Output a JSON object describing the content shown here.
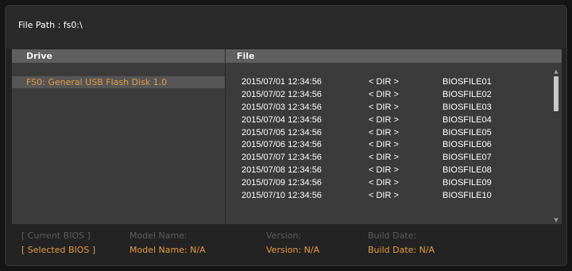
{
  "header": {
    "file_path": "File Path : fs0:\\"
  },
  "drive_panel": {
    "title": "Drive",
    "items": [
      {
        "label": "FS0: General USB Flash Disk 1.0",
        "selected": true
      }
    ]
  },
  "file_panel": {
    "title": "File",
    "rows": [
      {
        "date": "2015/07/01 12:34:56",
        "type": "< DIR >",
        "name": "BIOSFILE01"
      },
      {
        "date": "2015/07/02 12:34:56",
        "type": "< DIR >",
        "name": "BIOSFILE02"
      },
      {
        "date": "2015/07/03 12:34:56",
        "type": "< DIR >",
        "name": "BIOSFILE03"
      },
      {
        "date": "2015/07/04 12:34:56",
        "type": "< DIR >",
        "name": "BIOSFILE04"
      },
      {
        "date": "2015/07/05 12:34:56",
        "type": "< DIR >",
        "name": "BIOSFILE05"
      },
      {
        "date": "2015/07/06 12:34:56",
        "type": "< DIR >",
        "name": "BIOSFILE06"
      },
      {
        "date": "2015/07/07 12:34:56",
        "type": "< DIR >",
        "name": "BIOSFILE07"
      },
      {
        "date": "2015/07/08 12:34:56",
        "type": "< DIR >",
        "name": "BIOSFILE08"
      },
      {
        "date": "2015/07/09 12:34:56",
        "type": "< DIR >",
        "name": "BIOSFILE09"
      },
      {
        "date": "2015/07/10 12:34:56",
        "type": "< DIR >",
        "name": "BIOSFILE10"
      }
    ],
    "scrollbar": {
      "up_icon": "triangle-up-icon",
      "down_icon": "triangle-down-icon"
    }
  },
  "bios_info": {
    "current": {
      "label": "[ Current BIOS  ]",
      "model": "Model Name:",
      "version": "Version:",
      "build": "Build Date:"
    },
    "selected": {
      "label": "[ Selected BIOS ]",
      "model": "Model Name: N/A",
      "version": "Version: N/A",
      "build": "Build Date: N/A"
    }
  },
  "colors": {
    "accent": "#e59a42",
    "background": "#232323",
    "panel": "#3b3b3b",
    "panel_header": "#5f5f5f",
    "dimmed_text": "#5c5c5c"
  }
}
